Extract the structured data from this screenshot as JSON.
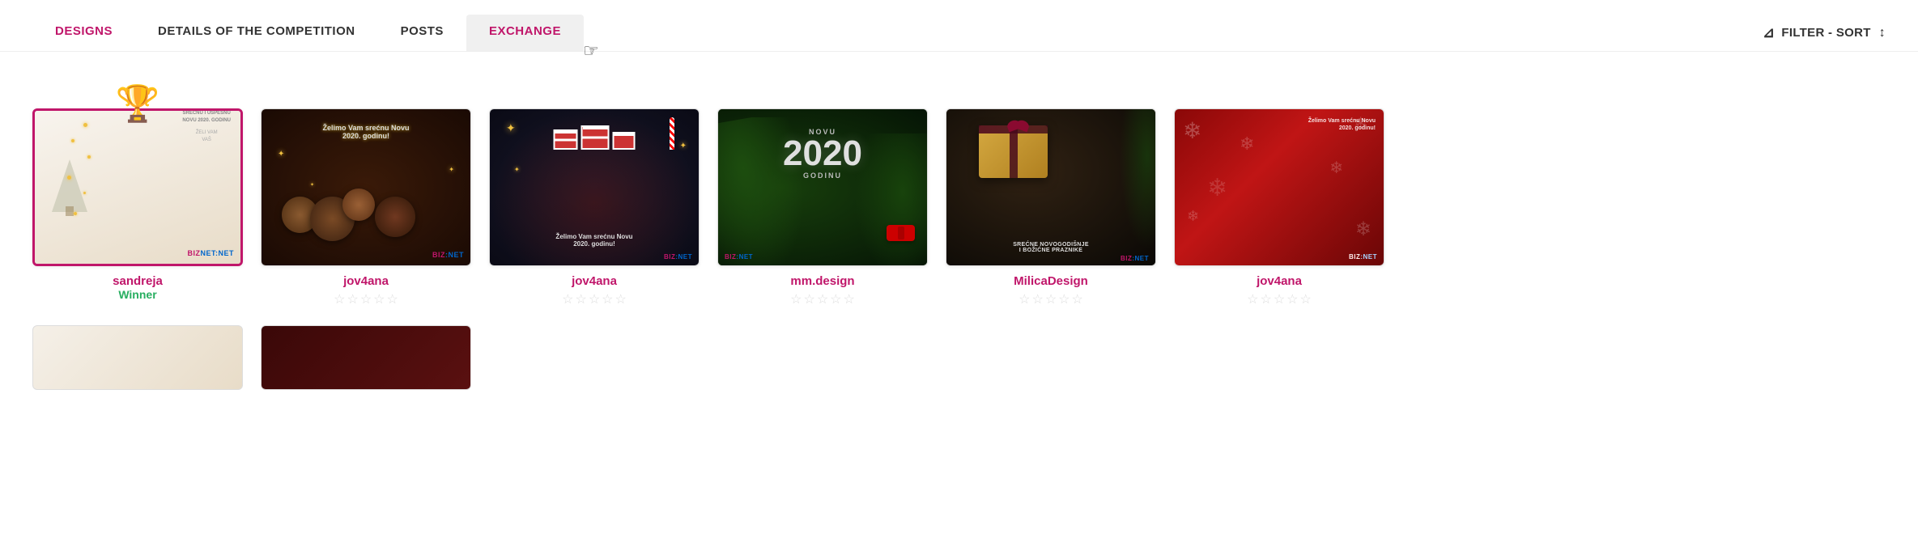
{
  "nav": {
    "tabs": [
      {
        "id": "designs",
        "label": "DESIGNS",
        "active": true,
        "style": "pink"
      },
      {
        "id": "details",
        "label": "DETAILS OF THE COMPETITION",
        "active": false,
        "style": "normal"
      },
      {
        "id": "posts",
        "label": "POSTS",
        "active": false,
        "style": "normal"
      },
      {
        "id": "exchange",
        "label": "EXCHANGE",
        "active": false,
        "style": "exchange-active"
      }
    ],
    "filter_label": "FILTER - SORT"
  },
  "cards": [
    {
      "id": 1,
      "designer": "sandreja",
      "is_winner": true,
      "winner_label": "Winner",
      "stars": [
        0,
        0,
        0,
        0,
        0
      ],
      "style": "card1"
    },
    {
      "id": 2,
      "designer": "jov4ana",
      "is_winner": false,
      "winner_label": "",
      "stars": [
        0,
        0,
        0,
        0,
        0
      ],
      "style": "card2"
    },
    {
      "id": 3,
      "designer": "jov4ana",
      "is_winner": false,
      "winner_label": "",
      "stars": [
        0,
        0,
        0,
        0,
        0
      ],
      "style": "card3"
    },
    {
      "id": 4,
      "designer": "mm.design",
      "is_winner": false,
      "winner_label": "",
      "stars": [
        0,
        0,
        0,
        0,
        0
      ],
      "style": "card4"
    },
    {
      "id": 5,
      "designer": "MilicaDesign",
      "is_winner": false,
      "winner_label": "",
      "stars": [
        0,
        0,
        0,
        0,
        0
      ],
      "style": "card5"
    },
    {
      "id": 6,
      "designer": "jov4ana",
      "is_winner": false,
      "winner_label": "",
      "stars": [
        0,
        0,
        0,
        0,
        0
      ],
      "style": "card6"
    }
  ],
  "bottom_partial_cards": [
    {
      "id": "p1",
      "style": "partial-light"
    },
    {
      "id": "p2",
      "style": "partial-dark"
    }
  ],
  "star_char": "☆",
  "trophy_char": "🏆",
  "biznet_text": "BIZ",
  "biznet_net": "NET",
  "zelimo_text1": "Želimo Vam srećnu Novu",
  "zelimo_text2": "2020. godinu!",
  "zelimo_text3": "Želimo Vam srećnu Novu 2020. godinu!",
  "novu_label": "SREĆNU I USPEŠNU",
  "novu_label2": "NOVU 2020. GODINU",
  "novu_label3": "ŽELI VAM",
  "novu_label4": "VAŠ",
  "novu_2020": "2020",
  "novu_top": "NOVU",
  "novu_godinu": "GODINU",
  "srece_label": "SREĆNE NOVOGODIŠNJE",
  "srece_label2": "I BOŽIĆNE PRAZNIKE",
  "colors": {
    "pink": "#c0166a",
    "green": "#27ae60",
    "star_empty": "#cccccc",
    "nav_active_bg": "#f0f0f0"
  }
}
